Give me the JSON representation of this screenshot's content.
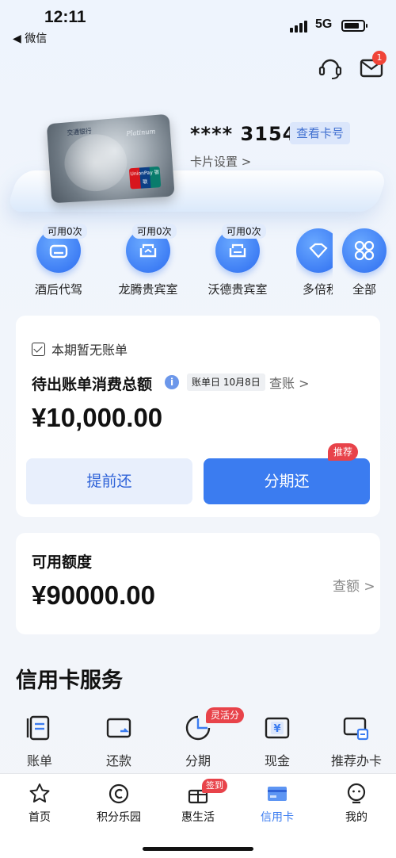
{
  "status_bar": {
    "time": "12:11",
    "back_app": "◀ 微信",
    "network": "5G"
  },
  "header": {
    "message_badge": "1"
  },
  "card": {
    "masked_number": "**** 3154",
    "view_number": "查看卡号",
    "settings": "卡片设置 >"
  },
  "card_image": {
    "bank_name": "交通银行",
    "tier": "Platinum",
    "brand": "UnionPay 银联"
  },
  "quick_actions": [
    {
      "label": "酒后代驾",
      "tag": "可用0次",
      "icon": "car-icon"
    },
    {
      "label": "龙腾贵宾室",
      "tag": "可用0次",
      "icon": "sofa-icon"
    },
    {
      "label": "沃德贵宾室",
      "tag": "可用0次",
      "icon": "sofa-icon"
    },
    {
      "label": "多倍积",
      "tag": "",
      "icon": "diamond-icon"
    },
    {
      "label": "全部",
      "tag": "",
      "icon": "grid-icon"
    }
  ],
  "bill": {
    "status": "本期暂无账单",
    "pending_title": "待出账单消费总额",
    "bill_day": "账单日 10月8日",
    "view_bill": "查账 >",
    "amount": "¥10,000.00",
    "prepay": "提前还",
    "installment": "分期还",
    "recommend_badge": "推荐"
  },
  "credit": {
    "title": "可用额度",
    "amount": "¥90000.00",
    "check": "查额 >"
  },
  "services": {
    "title": "信用卡服务",
    "items": [
      {
        "label": "账单",
        "icon": "bill-icon"
      },
      {
        "label": "还款",
        "icon": "repay-icon"
      },
      {
        "label": "分期",
        "icon": "installment-icon",
        "badge": "灵活分"
      },
      {
        "label": "现金",
        "icon": "cash-icon"
      },
      {
        "label": "推荐办卡",
        "icon": "apply-card-icon"
      }
    ]
  },
  "tabbar": {
    "items": [
      {
        "label": "首页",
        "icon": "star-icon"
      },
      {
        "label": "积分乐园",
        "icon": "points-icon"
      },
      {
        "label": "惠生活",
        "icon": "gift-icon",
        "badge": "签到"
      },
      {
        "label": "信用卡",
        "icon": "card-icon",
        "active": true
      },
      {
        "label": "我的",
        "icon": "user-icon"
      }
    ]
  },
  "colors": {
    "accent": "#3b7cf0",
    "badge": "#e8434a",
    "text": "#111111"
  }
}
